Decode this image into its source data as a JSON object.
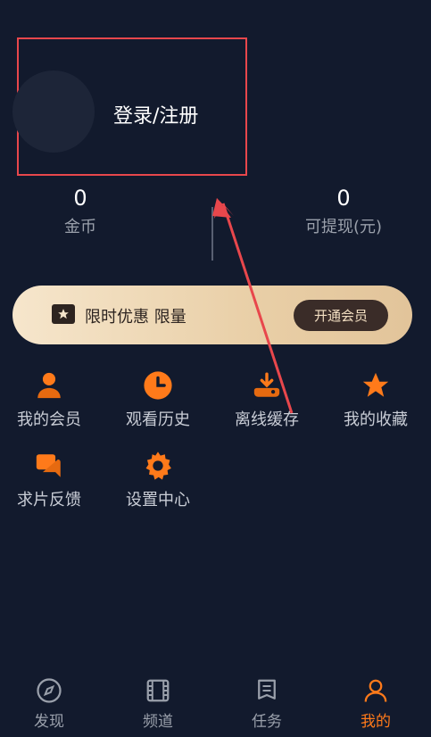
{
  "profile": {
    "login_label": "登录/注册"
  },
  "stats": [
    {
      "value": "0",
      "label": "金币"
    },
    {
      "value": "0",
      "label": "可提现(元)"
    }
  ],
  "vip": {
    "text": "限时优惠 限量",
    "button": "开通会员"
  },
  "features": [
    {
      "label": "我的会员",
      "icon": "user-icon"
    },
    {
      "label": "观看历史",
      "icon": "clock-icon"
    },
    {
      "label": "离线缓存",
      "icon": "download-icon"
    },
    {
      "label": "我的收藏",
      "icon": "star-icon"
    },
    {
      "label": "求片反馈",
      "icon": "chat-icon"
    },
    {
      "label": "设置中心",
      "icon": "gear-icon"
    }
  ],
  "tabs": [
    {
      "label": "发现",
      "icon": "compass-icon"
    },
    {
      "label": "频道",
      "icon": "film-icon"
    },
    {
      "label": "任务",
      "icon": "task-icon"
    },
    {
      "label": "我的",
      "icon": "profile-icon"
    }
  ],
  "colors": {
    "accent": "#ff7a1a",
    "background": "#121a2d",
    "highlight": "#e8474c"
  }
}
